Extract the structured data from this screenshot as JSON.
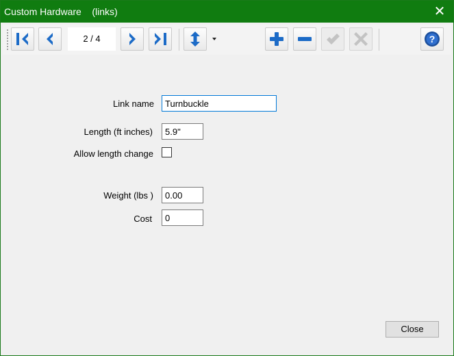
{
  "window": {
    "title": "Custom Hardware    (links)",
    "close_glyph": "✕"
  },
  "toolbar": {
    "pager_text": "2 / 4",
    "buttons": {
      "first": "first-record-icon",
      "prev": "previous-record-icon",
      "next": "next-record-icon",
      "last": "last-record-icon",
      "sort": "sort-icon",
      "add": "add-icon",
      "remove": "remove-icon",
      "confirm": "confirm-icon",
      "cancel": "cancel-icon",
      "help": "help-icon"
    }
  },
  "form": {
    "link_name_label": "Link name",
    "link_name_value": "Turnbuckle",
    "length_label": "Length (ft inches)",
    "length_value": "5.9\"",
    "allow_length_label": "Allow length change",
    "allow_length_checked": false,
    "weight_label": "Weight (lbs )",
    "weight_value": "0.00",
    "cost_label": "Cost",
    "cost_value": "0"
  },
  "footer": {
    "close_label": "Close"
  },
  "colors": {
    "titlebar": "#107c10",
    "icon_blue": "#1c6bc7",
    "accent_focus": "#0078d7"
  }
}
